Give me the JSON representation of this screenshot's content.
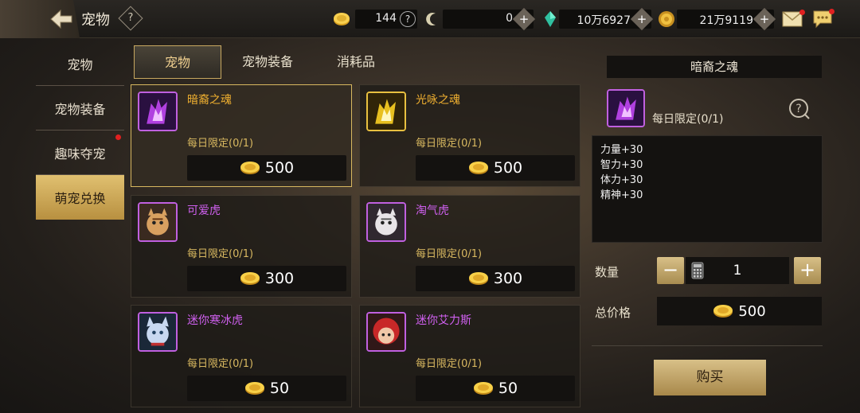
{
  "header": {
    "title": "宠物",
    "help": "?",
    "resources": [
      {
        "icon": "gold-coin-icon",
        "value": "144",
        "action": "?"
      },
      {
        "icon": "crescent-coin-icon",
        "value": "0",
        "action": "+"
      },
      {
        "icon": "green-crystal-icon",
        "value": "10万6927",
        "action": "+"
      },
      {
        "icon": "gold-medal-icon",
        "value": "21万9119",
        "action": "+"
      }
    ]
  },
  "sidebar": {
    "items": [
      {
        "label": "宠物",
        "active": false
      },
      {
        "label": "宠物装备",
        "active": false
      },
      {
        "label": "趣味夺宠",
        "active": false,
        "badge": true
      },
      {
        "label": "萌宠兑换",
        "active": true
      }
    ]
  },
  "tabs": [
    {
      "label": "宠物",
      "active": true
    },
    {
      "label": "宠物装备",
      "active": false
    },
    {
      "label": "消耗品",
      "active": false
    }
  ],
  "cards": [
    {
      "name": "暗裔之魂",
      "limit": "每日限定(0/1)",
      "price": "500",
      "name_color": "#f0b030",
      "selected": true,
      "portrait": "purple-soul"
    },
    {
      "name": "光咏之魂",
      "limit": "每日限定(0/1)",
      "price": "500",
      "name_color": "#f0b030",
      "selected": false,
      "portrait": "gold-soul"
    },
    {
      "name": "可爱虎",
      "limit": "每日限定(0/1)",
      "price": "300",
      "name_color": "#d060f0",
      "selected": false,
      "portrait": "tiger-orange"
    },
    {
      "name": "淘气虎",
      "limit": "每日限定(0/1)",
      "price": "300",
      "name_color": "#d060f0",
      "selected": false,
      "portrait": "tiger-white"
    },
    {
      "name": "迷你寒冰虎",
      "limit": "每日限定(0/1)",
      "price": "50",
      "name_color": "#d060f0",
      "selected": false,
      "portrait": "tiger-ice"
    },
    {
      "name": "迷你艾力斯",
      "limit": "每日限定(0/1)",
      "price": "50",
      "name_color": "#d060f0",
      "selected": false,
      "portrait": "red-hair"
    }
  ],
  "detail": {
    "title": "暗裔之魂",
    "limit": "每日限定(0/1)",
    "stats": [
      "力量+30",
      "智力+30",
      "体力+30",
      "精神+30"
    ],
    "quantity_label": "数量",
    "quantity": "1",
    "minus": "−",
    "plus": "+",
    "total_label": "总价格",
    "total": "500",
    "buy_label": "购买"
  }
}
